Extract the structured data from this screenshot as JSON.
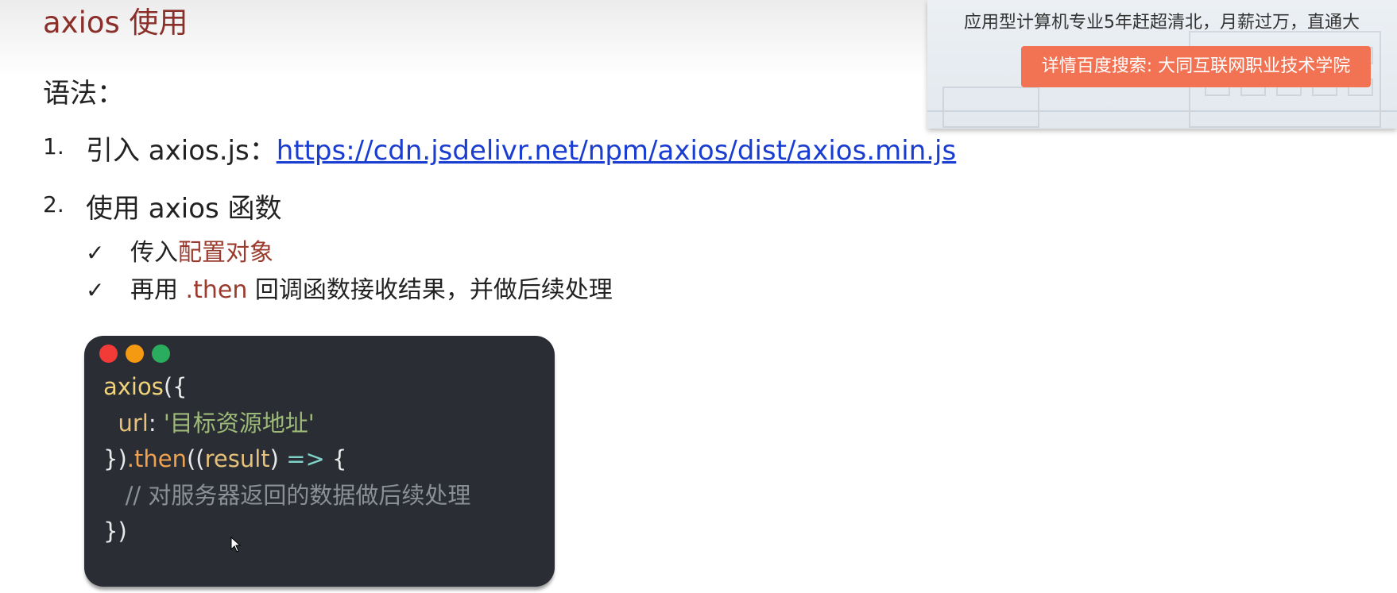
{
  "slide": {
    "title": "axios 使用",
    "syntax_label": "语法：",
    "items": [
      {
        "number": "1.",
        "label": "引入 axios.js：",
        "link": "https://cdn.jsdelivr.net/npm/axios/dist/axios.min.js"
      },
      {
        "number": "2.",
        "label": "使用 axios 函数"
      }
    ],
    "subitems": [
      {
        "check": "✓",
        "text": "传入",
        "highlight": "配置对象"
      },
      {
        "check": "✓",
        "text": "再用",
        "highlight": ".then",
        "text_after": "回调函数接收结果，并做后续处理"
      }
    ]
  },
  "code": {
    "line1_fn": "axios",
    "line1_punct": "({",
    "line2_key": "url",
    "line2_colon": ": ",
    "line2_str": "'目标资源地址'",
    "line3_a": "})",
    "line3_then": ".then",
    "line3_b": "((",
    "line3_param": "result",
    "line3_c": ") ",
    "line3_arrow": "=>",
    "line3_d": " {",
    "line4_comment": "// 对服务器返回的数据做后续处理",
    "line5": "})"
  },
  "ad": {
    "text": "应用型计算机专业5年赶超清北，月薪过万，直通大",
    "button": "详情百度搜索: 大同互联网职业技术学院"
  },
  "colors": {
    "title": "#8a2f2a",
    "link": "#1a3dd1",
    "highlight": "#9a3b2e",
    "code_bg": "#2a2d33",
    "ad_button": "#f27353"
  }
}
